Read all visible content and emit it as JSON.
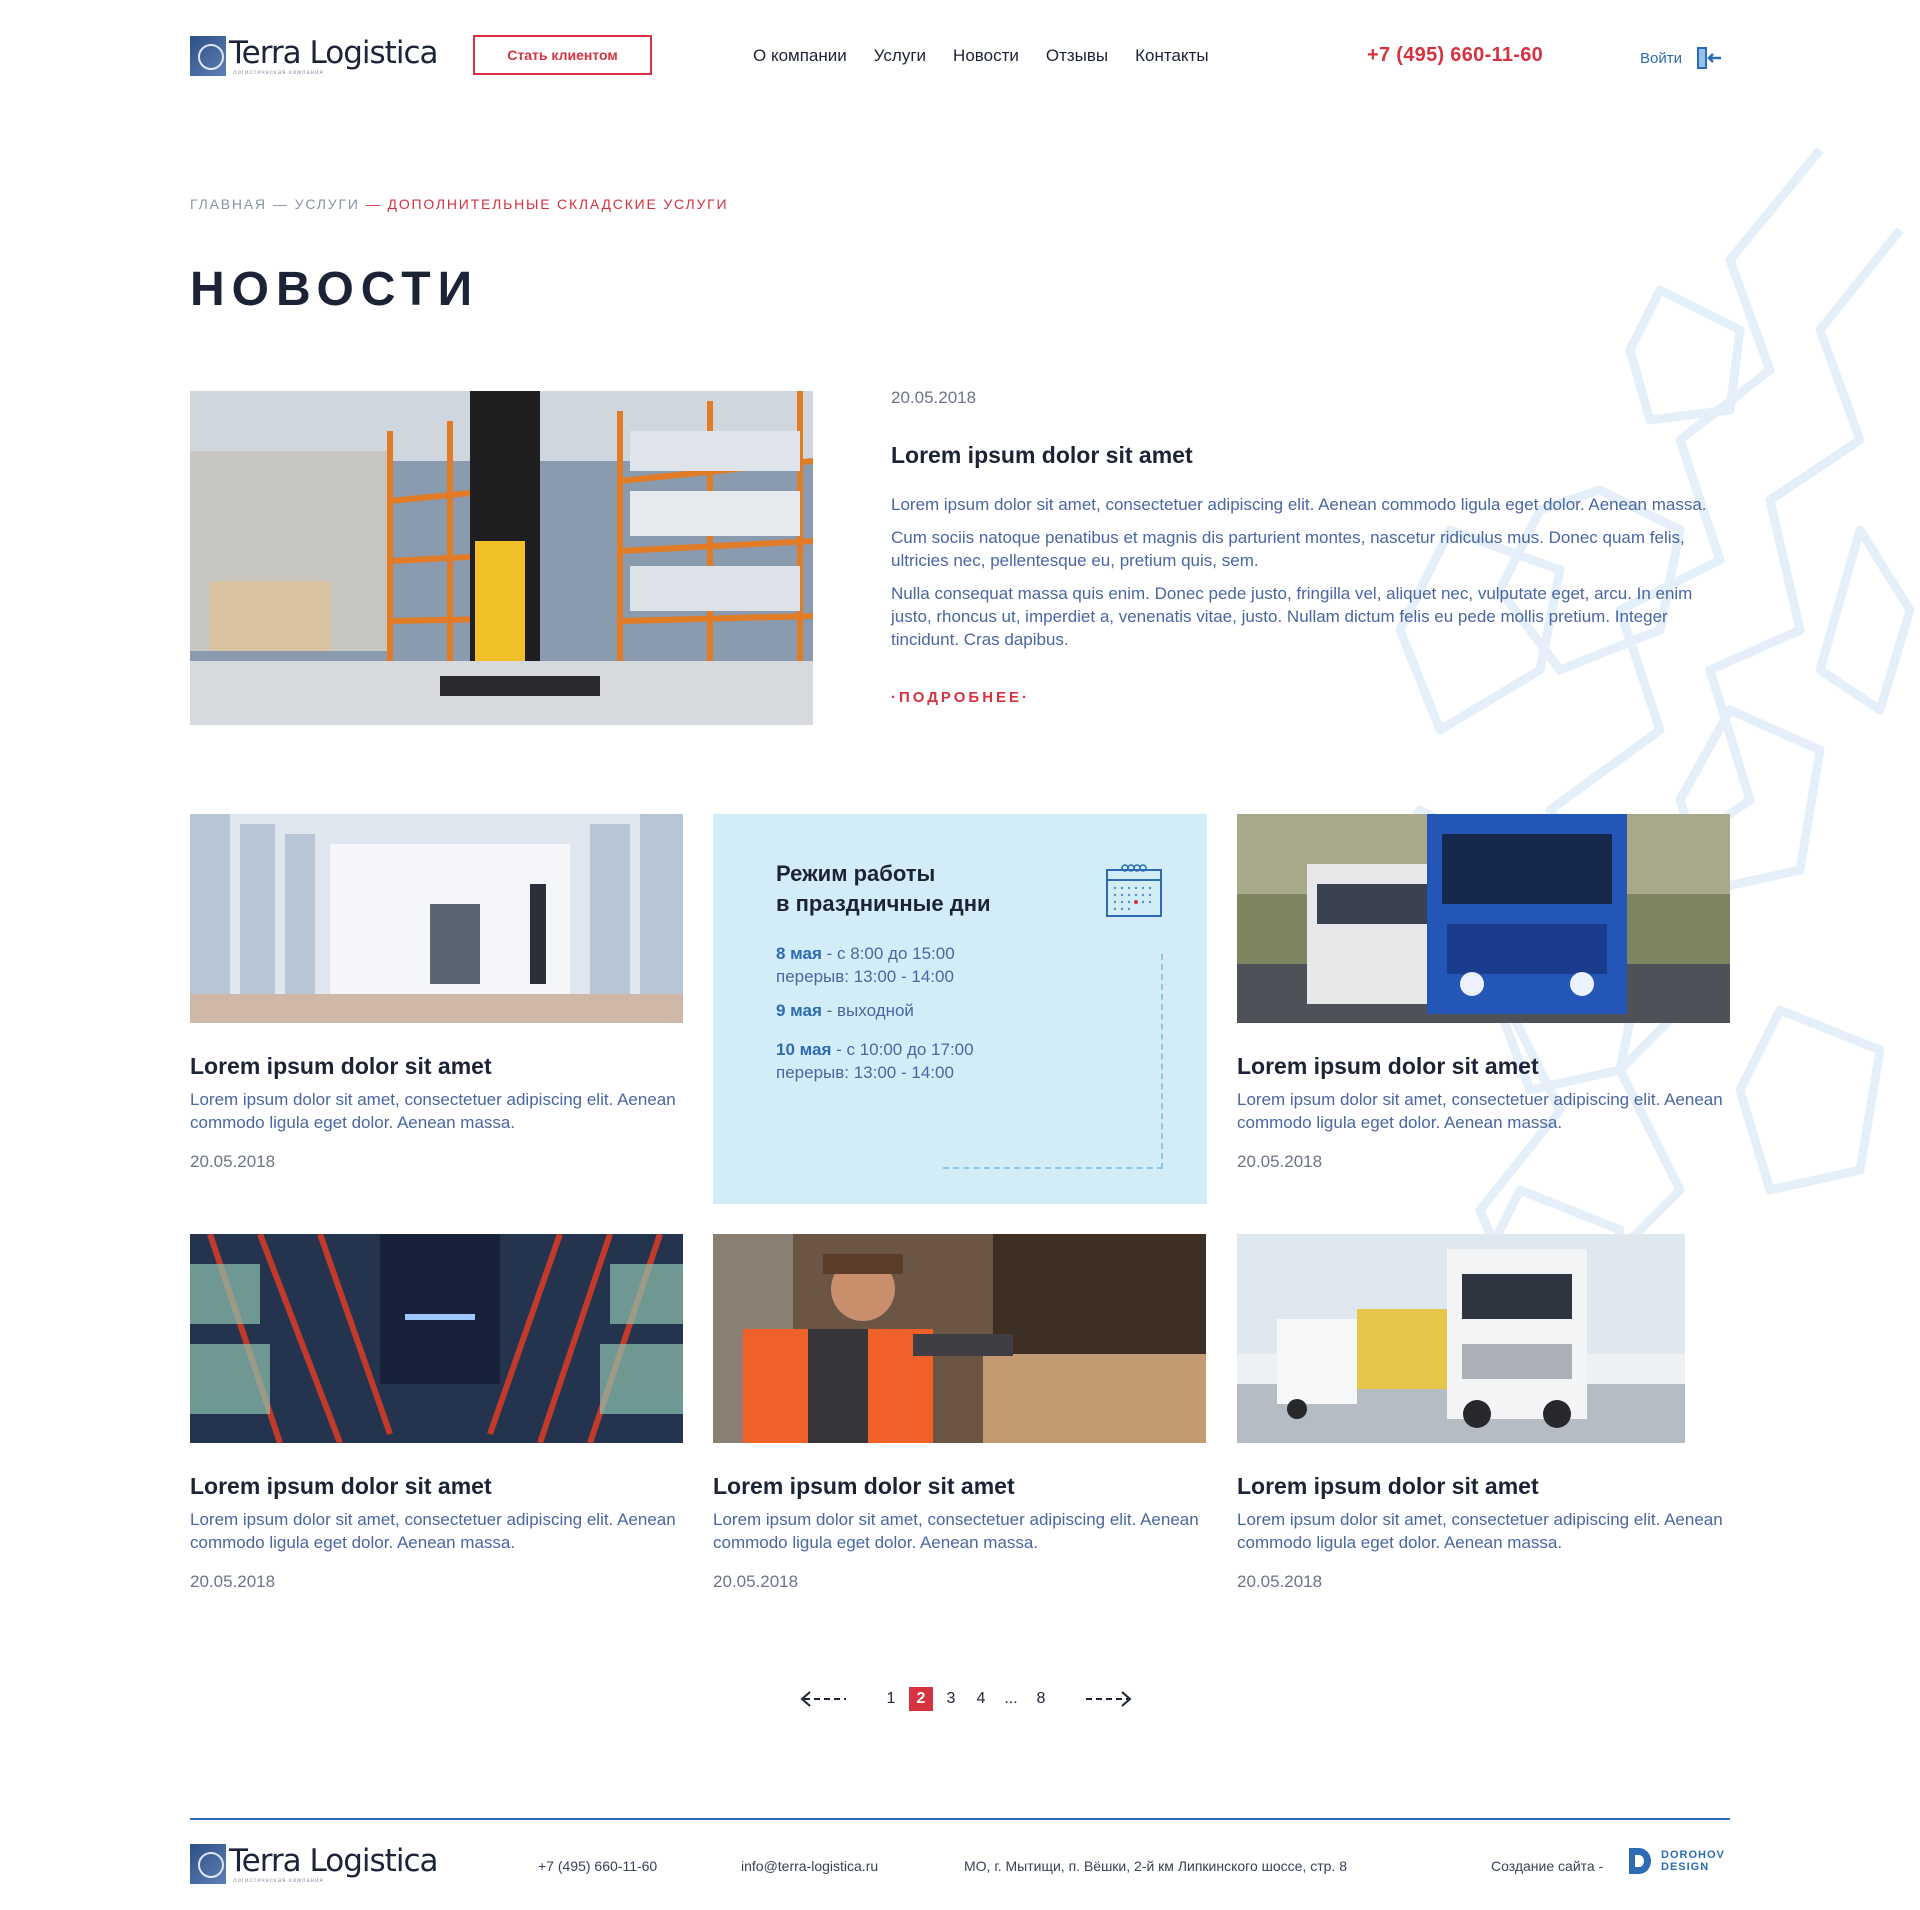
{
  "colors": {
    "accent_red": "#d6323f",
    "accent_blue": "#2d6bb5",
    "text_dark": "#1c2336",
    "text_blue": "#4a66a2",
    "holiday_bg": "#d3edf8"
  },
  "header": {
    "logo_name": "Terra Logistica",
    "logo_sub": "логистическая компания",
    "cta_label": "Стать клиентом",
    "nav": [
      "О компании",
      "Услуги",
      "Новости",
      "Отзывы",
      "Контакты"
    ],
    "phone": "+7 (495) 660-11-60",
    "login_label": "Войти",
    "login_icon": "login-door-icon"
  },
  "breadcrumb": {
    "items": [
      "Главная",
      "Услуги"
    ],
    "current": "Дополнительные складские услуги"
  },
  "page_title": "Новости",
  "featured": {
    "image": "warehouse-forklift-photo",
    "date": "20.05.2018",
    "title": "Lorem ipsum dolor sit amet",
    "paragraphs": [
      "Lorem ipsum dolor sit amet, consectetuer adipiscing elit. Aenean commodo ligula eget dolor. Aenean massa.",
      "Cum sociis natoque penatibus et magnis dis parturient montes, nascetur ridiculus mus. Donec quam felis, ultricies nec, pellentesque eu, pretium quis, sem.",
      "Nulla consequat massa quis enim. Donec pede justo, fringilla vel, aliquet nec, vulputate eget, arcu. In enim justo, rhoncus ut, imperdiet a, venenatis vitae, justo. Nullam dictum felis eu pede mollis pretium. Integer tincidunt. Cras dapibus."
    ],
    "more_label": "подробнее"
  },
  "cards": [
    {
      "image": "warehouse-aisle-forklift-photo",
      "title": "Lorem ipsum dolor sit amet",
      "text": "Lorem ipsum dolor sit amet, consectetuer adipiscing elit. Aenean commodo ligula eget dolor. Aenean massa.",
      "date": "20.05.2018"
    },
    {
      "image": "blue-trucks-road-photo",
      "title": "Lorem ipsum dolor sit amet",
      "text": "Lorem ipsum dolor sit amet, consectetuer adipiscing elit. Aenean commodo ligula eget dolor. Aenean massa.",
      "date": "20.05.2018"
    },
    {
      "image": "warehouse-racks-photo",
      "title": "Lorem ipsum dolor sit amet",
      "text": "Lorem ipsum dolor sit amet, consectetuer adipiscing elit. Aenean commodo ligula eget dolor. Aenean massa.",
      "date": "20.05.2018"
    },
    {
      "image": "worker-boxes-photo",
      "title": "Lorem ipsum dolor sit amet",
      "text": "Lorem ipsum dolor sit amet, consectetuer adipiscing elit. Aenean commodo ligula eget dolor. Aenean massa.",
      "date": "20.05.2018"
    },
    {
      "image": "white-trucks-photo",
      "title": "Lorem ipsum dolor sit amet",
      "text": "Lorem ipsum dolor sit amet, consectetuer adipiscing elit. Aenean commodo ligula eget dolor. Aenean massa.",
      "date": "20.05.2018"
    }
  ],
  "holiday": {
    "title_line1": "Режим работы",
    "title_line2": "в праздничные дни",
    "icon": "calendar-icon",
    "rows": [
      {
        "day": "8 мая",
        "time": " - с 8:00 до 15:00",
        "break": "перерыв: 13:00 - 14:00"
      },
      {
        "day": "9 мая",
        "time": " - выходной",
        "break": ""
      },
      {
        "day": "10 мая",
        "time": " - с 10:00 до 17:00",
        "break": "перерыв: 13:00 - 14:00"
      }
    ]
  },
  "pagination": {
    "pages": [
      "1",
      "2",
      "3",
      "4"
    ],
    "current": "2",
    "dots": "...",
    "last": "8"
  },
  "footer": {
    "logo_name": "Terra Logistica",
    "logo_sub": "логистическая компания",
    "phone": "+7 (495) 660-11-60",
    "email": "info@terra-logistica.ru",
    "address": "МО, г. Мытищи, п. Вёшки, 2-й км Липкинского шоссе, стр. 8",
    "made_by": "Создание сайта -",
    "studio_line1": "DOROHOV",
    "studio_line2": "DESIGN"
  }
}
